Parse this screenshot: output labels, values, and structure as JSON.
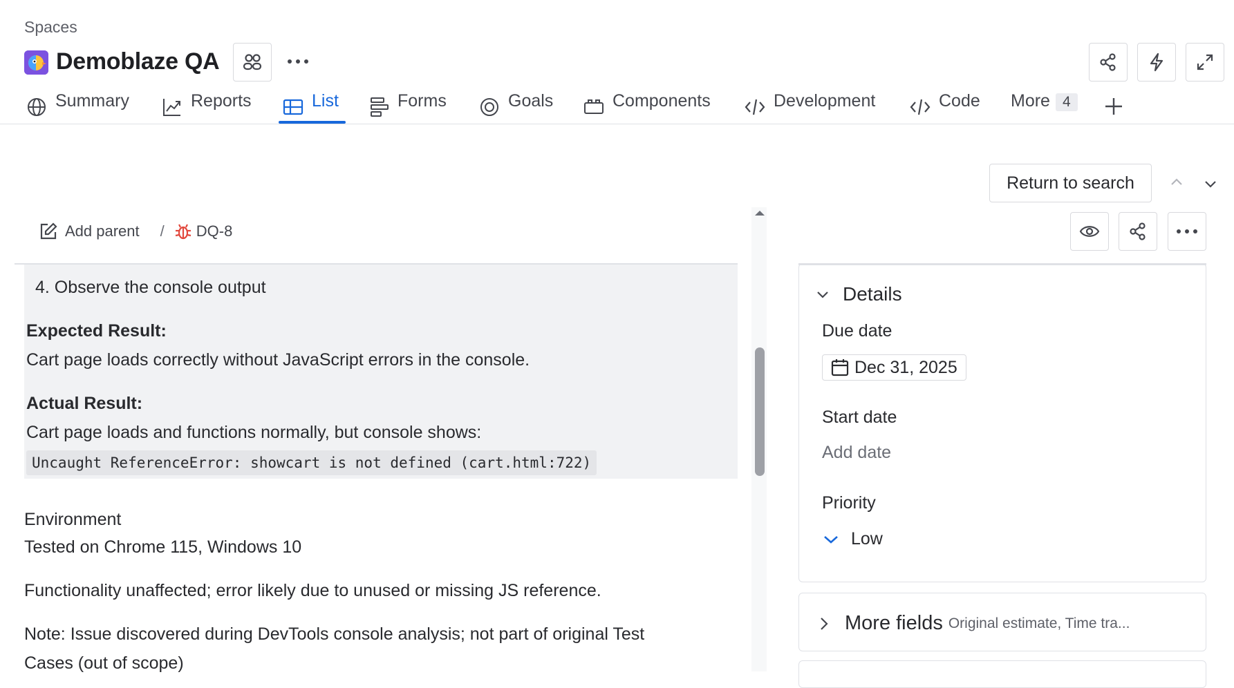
{
  "header": {
    "breadcrumb": "Spaces",
    "title": "Demoblaze QA"
  },
  "tabs": [
    {
      "label": "Summary",
      "icon": "globe-icon"
    },
    {
      "label": "Reports",
      "icon": "chart-line-icon"
    },
    {
      "label": "List",
      "icon": "table-icon",
      "active": true
    },
    {
      "label": "Forms",
      "icon": "forms-icon"
    },
    {
      "label": "Goals",
      "icon": "target-icon"
    },
    {
      "label": "Components",
      "icon": "components-icon"
    },
    {
      "label": "Development",
      "icon": "code-slash-icon"
    },
    {
      "label": "Code",
      "icon": "code-icon"
    },
    {
      "label": "More",
      "count": "4"
    }
  ],
  "issue": {
    "add_parent": "Add parent",
    "separator": "/",
    "key": "DQ-8",
    "description": {
      "step": "4. Observe the console output",
      "expected_heading": "Expected Result:",
      "expected_text": "Cart page loads correctly without JavaScript errors in the console.",
      "actual_heading": "Actual Result:",
      "actual_text": "Cart page loads and functions normally, but console shows:",
      "code": "Uncaught ReferenceError: showcart is not defined (cart.html:722)"
    },
    "environment_heading": "Environment",
    "environment_text": "Tested on Chrome 115, Windows 10",
    "note1": "Functionality unaffected; error likely due to unused or missing JS reference.",
    "note2_line1": "Note: Issue discovered during DevTools console analysis; not part of original Test",
    "note2_line2": "Cases (out of scope)"
  },
  "side_panel": {
    "return_button": "Return to search",
    "details_title": "Details",
    "due_date_label": "Due date",
    "due_date_value": "Dec 31, 2025",
    "start_date_label": "Start date",
    "start_date_placeholder": "Add date",
    "priority_label": "Priority",
    "priority_value": "Low",
    "more_fields_title": "More fields",
    "more_fields_hint": "Original estimate, Time tra..."
  },
  "colors": {
    "accent": "#1868db",
    "bug_icon": "#e2483d",
    "panel_bg": "#f1f2f4"
  }
}
